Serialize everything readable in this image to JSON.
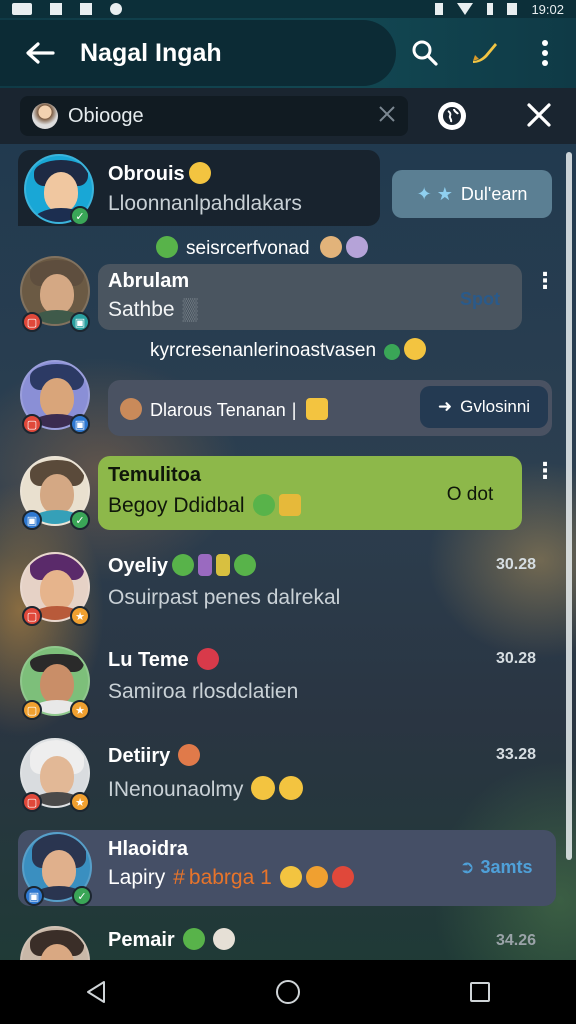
{
  "status_bar": {
    "time": "19:02"
  },
  "app_bar": {
    "title": "Nagal Ingah",
    "back_icon": "arrow-left-icon",
    "search_icon": "search-icon",
    "pen_icon": "pen-icon",
    "more_icon": "more-vertical-icon"
  },
  "search": {
    "value": "Obiooge",
    "clear_icon": "close-icon",
    "globe_icon": "globe-icon",
    "close_icon": "close-icon"
  },
  "chats": [
    {
      "name": "Obrouis",
      "preview": "Lloonnanlpahdlakars",
      "chip": "Dul'earn",
      "subline": "seisrcerfvonad"
    },
    {
      "name": "Abrulam",
      "preview": "Sathbe",
      "chip": "Spot",
      "subline": "kyrcresenanlerinoastvasen"
    },
    {
      "name": "Dlarous Tenanan",
      "chip": "Gvlosinni"
    },
    {
      "name": "Temulitoa",
      "preview": "Begoy Ddidbal",
      "chip": "O dot"
    },
    {
      "name": "Oyeliy",
      "preview": "Osuirpast penes dalrekal",
      "time": "30.28"
    },
    {
      "name": "Lu Teme",
      "preview": "Samiroa rlosdclatien",
      "time": "30.28"
    },
    {
      "name": "Detiiry",
      "preview": "INenounaolmy",
      "time": "33.28"
    },
    {
      "name": "Hlaoidra",
      "preview": "Lapiry",
      "preview_tag": "babrga 1",
      "chip": "3amts"
    },
    {
      "name": "Pemair",
      "time": "34.26"
    }
  ],
  "colors": {
    "app_bar": "#124752",
    "highlight_green": "#8db84a",
    "chip_blue": "#5b7f93",
    "badge_green": "#3aa657",
    "badge_orange": "#f0a030",
    "badge_red": "#e0483a"
  },
  "nav": {
    "back_icon": "nav-back-icon",
    "home_icon": "nav-home-icon",
    "recent_icon": "nav-recent-icon"
  }
}
